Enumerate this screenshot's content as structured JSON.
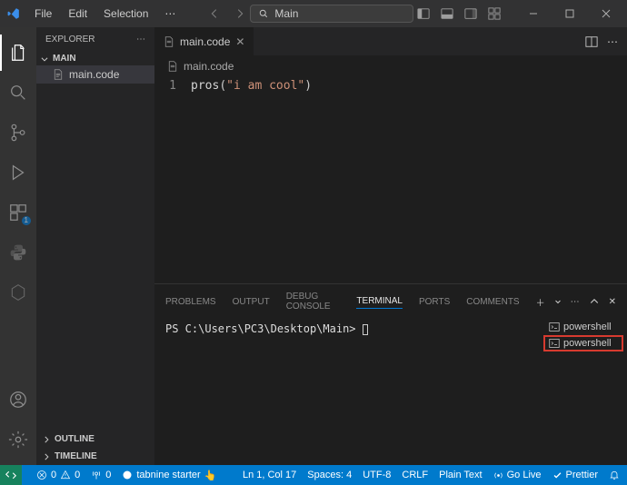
{
  "window": {
    "menus": [
      "File",
      "Edit",
      "Selection"
    ],
    "title": "Main"
  },
  "explorer": {
    "title": "EXPLORER",
    "folder": "MAIN",
    "files": [
      "main.code"
    ],
    "sections": {
      "outline": "OUTLINE",
      "timeline": "TIMELINE"
    }
  },
  "editor": {
    "tab_label": "main.code",
    "breadcrumb": "main.code",
    "line_no": "1",
    "code_fn": "pros",
    "code_open": "(",
    "code_str": "\"i am cool\"",
    "code_close": ")"
  },
  "panel": {
    "tabs": {
      "problems": "PROBLEMS",
      "output": "OUTPUT",
      "debug": "DEBUG CONSOLE",
      "terminal": "TERMINAL",
      "ports": "PORTS",
      "comments": "COMMENTS"
    },
    "prompt": "PS C:\\Users\\PC3\\Desktop\\Main>",
    "terminals": [
      "powershell",
      "powershell"
    ]
  },
  "status": {
    "errors": "0",
    "warnings": "0",
    "ports": "0",
    "tabnine": "tabnine starter",
    "cursor": "Ln 1, Col 17",
    "spaces": "Spaces: 4",
    "encoding": "UTF-8",
    "eol": "CRLF",
    "lang": "Plain Text",
    "golive": "Go Live",
    "prettier": "Prettier"
  }
}
